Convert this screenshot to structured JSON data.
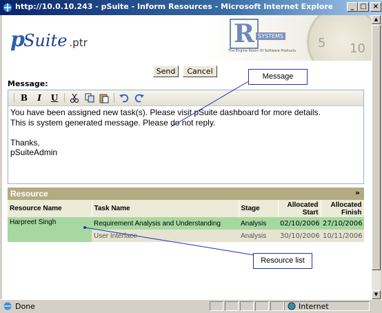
{
  "window": {
    "title": "http://10.0.10.243 - pSuite - Inform Resources - Microsoft Internet Explorer provided by R S...",
    "minimize": "_",
    "maximize": "□",
    "close": "×"
  },
  "header": {
    "logo_p": "p",
    "logo_suite": "Suite",
    "logo_ptr": ".ptr",
    "partner_mark": "R",
    "partner_name": "SYSTEMS",
    "partner_tagline": "The Engine Room Of Software Products",
    "clock_numbers": [
      "5",
      "10"
    ]
  },
  "actions": {
    "send_label": "Send",
    "cancel_label": "Cancel"
  },
  "message": {
    "label": "Message:",
    "toolbar": {
      "bold": "B",
      "italic": "I",
      "underline": "U",
      "cut_icon": "scissors",
      "copy_icon": "copy",
      "paste_icon": "paste",
      "undo_icon": "undo",
      "redo_icon": "redo"
    },
    "body": "You have been assigned new task(s). Please visit pSuite dashboard for more details.\nThis is system generated message. Please do not reply.\n\nThanks,\npSuiteAdmin"
  },
  "resource": {
    "title": "Resource",
    "collapse_glyph": "»",
    "columns": {
      "name": "Resource Name",
      "task": "Task Name",
      "stage": "Stage",
      "start": "Allocated Start",
      "finish": "Allocated Finish"
    },
    "person": "Harpreet Singh",
    "rows": [
      {
        "task": "Requirement Analysis and Understanding",
        "stage": "Analysis",
        "start": "02/10/2006",
        "finish": "27/10/2006"
      },
      {
        "task": "User Interface",
        "stage": "Analysis",
        "start": "30/10/2006",
        "finish": "10/11/2006"
      }
    ]
  },
  "annotations": {
    "message": "Message",
    "resource_list": "Resource list"
  },
  "statusbar": {
    "status": "Done",
    "zone": "Internet"
  },
  "colors": {
    "resource_header": "#b3ab82",
    "row_highlight": "#a6d8a0",
    "title_bar": "#0a246a"
  }
}
